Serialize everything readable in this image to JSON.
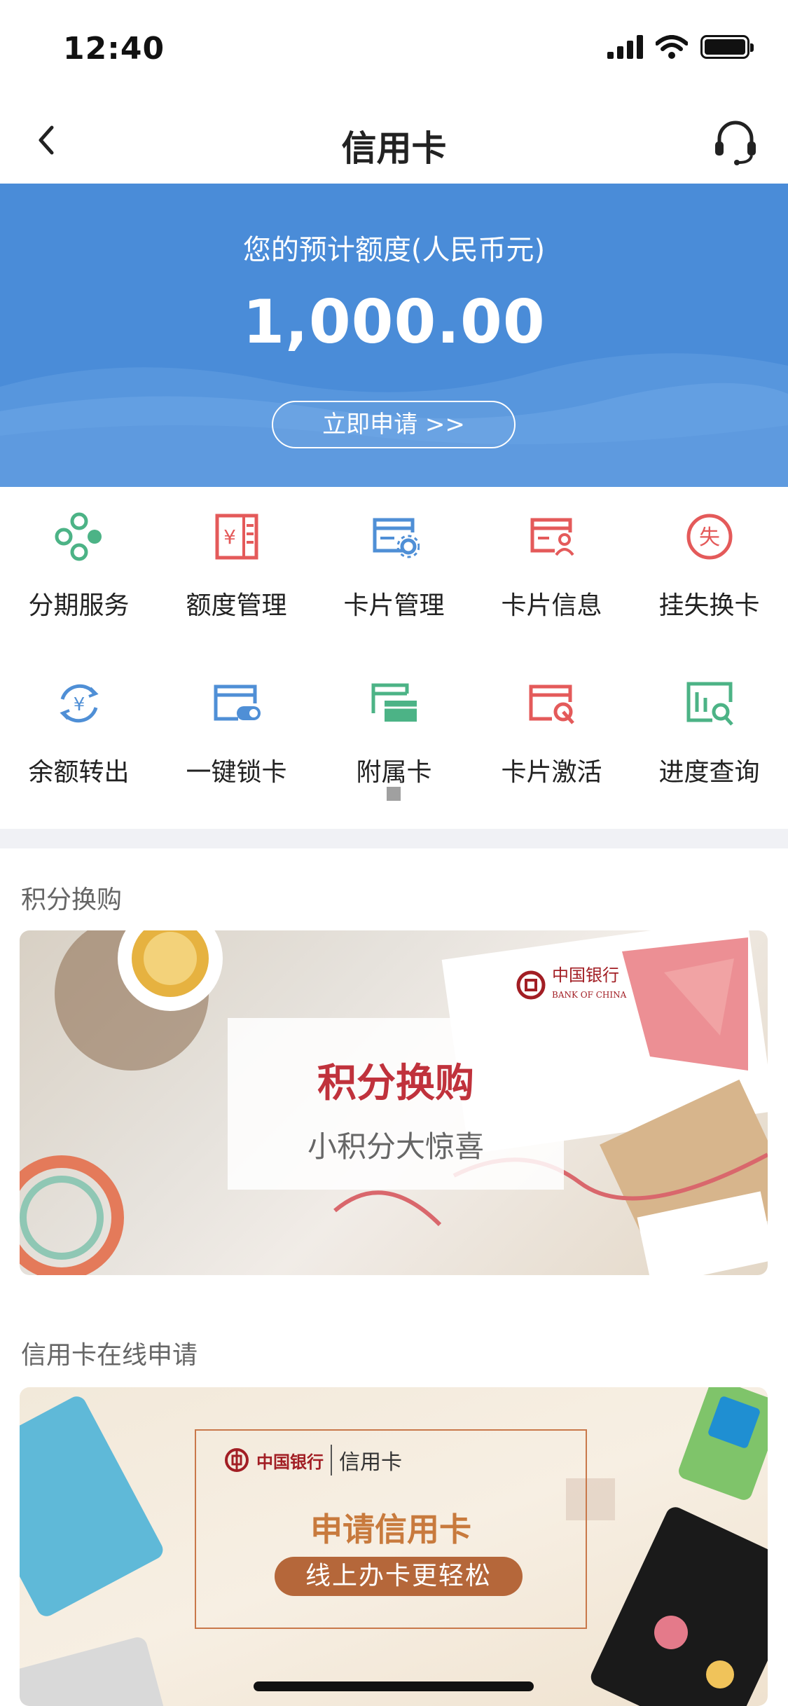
{
  "status_bar": {
    "time": "12:40"
  },
  "nav": {
    "title": "信用卡"
  },
  "hero": {
    "label": "您的预计额度(人民币元)",
    "amount": "1,000.00",
    "apply_button": "立即申请 >>"
  },
  "services": [
    {
      "label": "分期服务",
      "icon": "installment-icon",
      "color": "#4cb386"
    },
    {
      "label": "额度管理",
      "icon": "limit-icon",
      "color": "#e45a5a"
    },
    {
      "label": "卡片管理",
      "icon": "card-settings-icon",
      "color": "#4f8fd6"
    },
    {
      "label": "卡片信息",
      "icon": "card-user-icon",
      "color": "#e45a5a"
    },
    {
      "label": "挂失换卡",
      "icon": "report-loss-icon",
      "color": "#e45a5a"
    },
    {
      "label": "余额转出",
      "icon": "balance-transfer-icon",
      "color": "#4f8fd6"
    },
    {
      "label": "一键锁卡",
      "icon": "card-lock-icon",
      "color": "#4f8fd6"
    },
    {
      "label": "附属卡",
      "icon": "supplementary-card-icon",
      "color": "#4cb386"
    },
    {
      "label": "卡片激活",
      "icon": "card-activate-icon",
      "color": "#e45a5a"
    },
    {
      "label": "进度查询",
      "icon": "progress-query-icon",
      "color": "#4cb386"
    }
  ],
  "points_section": {
    "title": "积分换购",
    "banner_title": "积分换购",
    "banner_subtitle": "小积分大惊喜",
    "bank_logo": "中国银行 BANK OF CHINA"
  },
  "apply_section": {
    "title": "信用卡在线申请",
    "bank_logo": "中国银行",
    "card_label": "信用卡",
    "banner_title": "申请信用卡",
    "banner_pill": "线上办卡更轻松"
  },
  "colors": {
    "hero": "#4a8cd8",
    "accent_red": "#c0323c",
    "brown": "#b5673a"
  }
}
